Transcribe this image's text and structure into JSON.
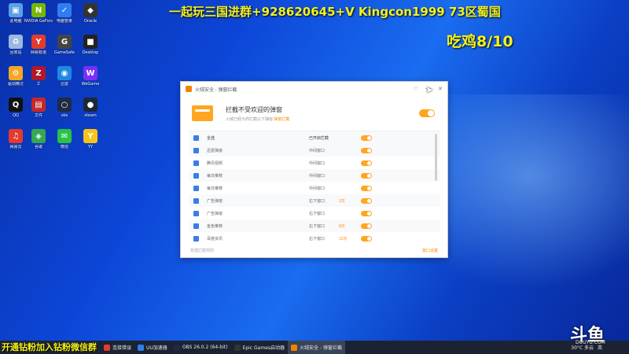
{
  "overlay": {
    "title": "一起玩三国进群+928620645+V Kingcon1999 73区蜀国",
    "score": "吃鸡8/10",
    "bottom_banner": "开通钻粉加入钻粉微信群"
  },
  "watermark": {
    "brand": "斗鱼",
    "sub": "DOUYU.COM"
  },
  "desktop_icons": [
    {
      "label": "此电脑",
      "color": "#5aa0e6",
      "glyph": "▣"
    },
    {
      "label": "NVIDIA GeForce",
      "color": "#76b900",
      "glyph": "N"
    },
    {
      "label": "电脑管家",
      "color": "#2f7df0",
      "glyph": "✓"
    },
    {
      "label": "Oracle",
      "color": "#333333",
      "glyph": "◆"
    },
    {
      "label": "回收站",
      "color": "#9ab8e0",
      "glyph": "♻"
    },
    {
      "label": "网易有道",
      "color": "#e33b2d",
      "glyph": "Y"
    },
    {
      "label": "GameSafe",
      "color": "#444444",
      "glyph": "G"
    },
    {
      "label": "Desktop",
      "color": "#222222",
      "glyph": "■"
    },
    {
      "label": "驱动精灵",
      "color": "#f5a623",
      "glyph": "⚙"
    },
    {
      "label": "Z",
      "color": "#b0182a",
      "glyph": "Z"
    },
    {
      "label": "迅雷",
      "color": "#1e88e5",
      "glyph": "◉"
    },
    {
      "label": "WeGame",
      "color": "#7b2ff7",
      "glyph": "W"
    },
    {
      "label": "QQ",
      "color": "#111111",
      "glyph": "Q"
    },
    {
      "label": "文件",
      "color": "#c62828",
      "glyph": "▤"
    },
    {
      "label": "obs",
      "color": "#1f2a44",
      "glyph": "○"
    },
    {
      "label": "steam",
      "color": "#1b2838",
      "glyph": "●"
    },
    {
      "label": "网易云",
      "color": "#e33b2d",
      "glyph": "♫"
    },
    {
      "label": "谷歌",
      "color": "#34a853",
      "glyph": "◈"
    },
    {
      "label": "微信",
      "color": "#28c445",
      "glyph": "✉"
    },
    {
      "label": "YY",
      "color": "#f5c518",
      "glyph": "Y"
    }
  ],
  "dialog": {
    "title": "火绒安全 - 弹窗拦截",
    "header_title": "拦截不受欢迎的弹窗",
    "header_sub": "火绒已经为你拦截以下弹窗",
    "header_link": "弹窗拦截",
    "columns": {
      "name": "全选",
      "status": "已开启拦截"
    },
    "rows": [
      {
        "name": "迅雷弹窗",
        "status": "中间窗口",
        "count": ""
      },
      {
        "name": "腾讯视频",
        "status": "中间窗口",
        "count": ""
      },
      {
        "name": "每日推荐",
        "status": "中间窗口",
        "count": ""
      },
      {
        "name": "每日推荐",
        "status": "中间窗口",
        "count": ""
      },
      {
        "name": "广告弹窗",
        "status": "右下窗口",
        "count": "2次"
      },
      {
        "name": "广告弹窗",
        "status": "右下窗口",
        "count": ""
      },
      {
        "name": "金色推荐",
        "status": "右下窗口",
        "count": "8次"
      },
      {
        "name": "百度资讯",
        "status": "右下窗口",
        "count": "12次"
      }
    ],
    "footer_left": "管理拦截规则",
    "footer_right": "窗口设置"
  },
  "taskbar": {
    "items": [
      {
        "label": "连接错误",
        "color": "#e33b2d"
      },
      {
        "label": "UU加速器",
        "color": "#2f7df0"
      },
      {
        "label": "OBS 26.0.2 (64-bit)",
        "color": "#1f2a44"
      },
      {
        "label": "Epic Games启动器",
        "color": "#333333"
      },
      {
        "label": "火绒安全 - 弹窗拦截",
        "color": "#f08300"
      }
    ],
    "weather": "30°C 多云",
    "language": "英"
  }
}
